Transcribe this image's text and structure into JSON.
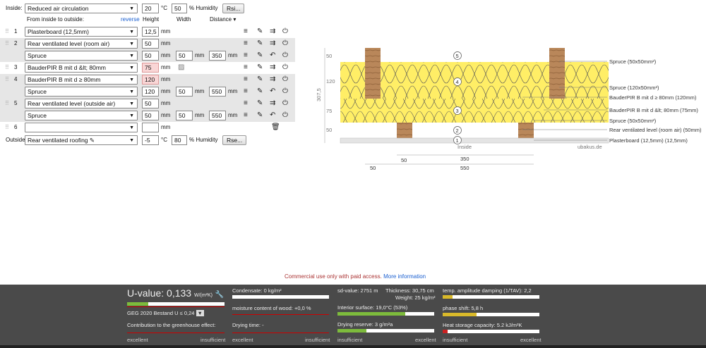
{
  "inside": {
    "label": "Inside:",
    "ventilation": "Reduced air circulation",
    "temp": "20",
    "temp_unit": "°C",
    "humidity": "50",
    "humidity_unit": "% Humidity",
    "rsi_button": "Rsi..."
  },
  "columns": {
    "from_label": "From inside to outside:",
    "reverse": "reverse",
    "height": "Height",
    "width": "Width",
    "distance": "Distance ▾"
  },
  "layers": [
    {
      "num": "1",
      "material": "Plasterboard (12,5mm)",
      "height": "12,5",
      "unit": "mm"
    },
    {
      "num": "2",
      "material": "Rear ventilated level (room air)",
      "height": "50",
      "unit": "mm",
      "sub": {
        "material": "Spruce",
        "height": "50",
        "width": "50",
        "distance": "350",
        "unit": "mm"
      }
    },
    {
      "num": "3",
      "material": "BauderPIR B mit d &lt; 80mm",
      "height": "75",
      "unit": "mm"
    },
    {
      "num": "4",
      "material": "BauderPIR B mit d ≥ 80mm",
      "height": "120",
      "unit": "mm",
      "sub": {
        "material": "Spruce",
        "height": "120",
        "width": "50",
        "distance": "550",
        "unit": "mm"
      }
    },
    {
      "num": "5",
      "material": "Rear ventilated level (outside air)",
      "height": "50",
      "unit": "mm",
      "sub": {
        "material": "Spruce",
        "height": "50",
        "width": "50",
        "distance": "550",
        "unit": "mm"
      }
    },
    {
      "num": "6",
      "material": "",
      "height": "",
      "unit": "mm"
    }
  ],
  "outside": {
    "label": "Outside",
    "material": "Rear ventilated roofing",
    "temp": "-5",
    "temp_unit": "°C",
    "humidity": "80",
    "humidity_unit": "% Humidity",
    "rse_button": "Rse..."
  },
  "diagram": {
    "left_dims": [
      "50",
      "120",
      "75",
      "50"
    ],
    "total": "307,5",
    "circles": [
      "5",
      "4",
      "3",
      "2",
      "1"
    ],
    "inside_label": "Inside",
    "watermark": "ubakus.de",
    "legend": [
      "Spruce (50x50mm²)",
      "Spruce (120x50mm²)",
      "BauderPIR B mit d ≥ 80mm (120mm)",
      "BauderPIR B mit d &lt; 80mm (75mm)",
      "Spruce (50x50mm²)",
      "Rear ventilated level (room air) (50mm)",
      "Plasterboard (12,5mm) (12,5mm)"
    ],
    "bottom_dims": [
      "50",
      "350",
      "50",
      "550"
    ]
  },
  "notice": {
    "text": "Commercial use only with paid access.",
    "link": "More information"
  },
  "footer": {
    "uvalue_label": "U-value:",
    "uvalue": "0,133",
    "uvalue_unit": "W/(m²K)",
    "geg": "GEG 2020 Bestand U ≤ 0,24",
    "greenhouse": "Contribution to the greenhouse effect:",
    "condensate": "Condensate: 0 kg/m²",
    "moisture": "moisture content of wood: +0,0 %",
    "drying": "Drying time: -",
    "sd": "sd-value: 2751 m",
    "thickness": "Thickness: 30,75 cm",
    "weight": "Weight: 25 kg/m²",
    "surface": "Interior surface: 19,0°C (53%)",
    "reserve": "Drying reserve: 3 g/m²a",
    "damping": "temp. amplitude damping (1/TAV): 2,2",
    "phase": "phase shift: 5,8 h",
    "heatstore": "Heat storage capacity: 5.2 kJ/m²K",
    "excellent": "excellent",
    "insufficient": "insufficient",
    "bars": {
      "uvalue": 0.22,
      "condensate": 0.0,
      "surface": 0.7,
      "reserve": 0.3,
      "damping": 0.1,
      "phase": 0.35,
      "heatstore": 0.05
    },
    "colors": {
      "good": "#7dbb3c",
      "ok": "#d9b92a",
      "bad": "#cc2222"
    }
  }
}
